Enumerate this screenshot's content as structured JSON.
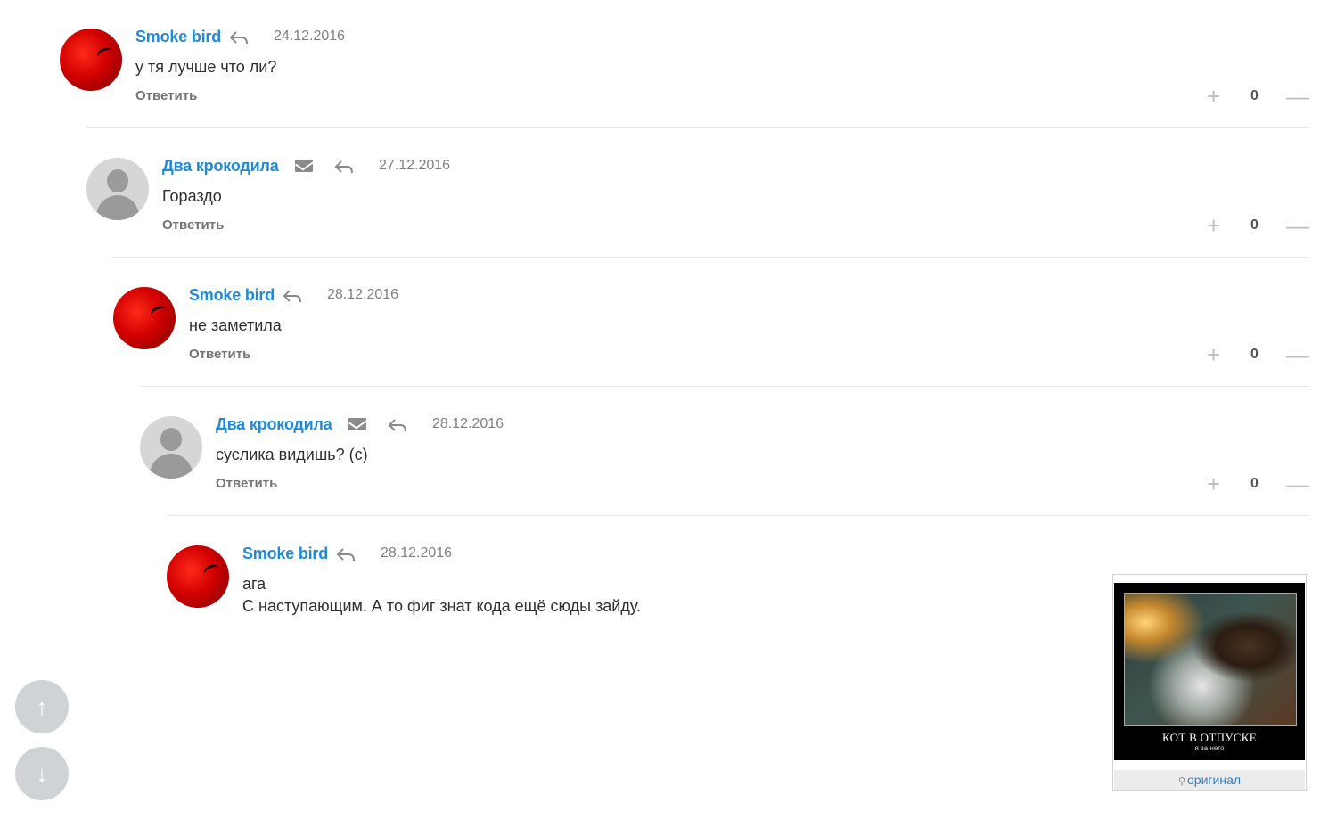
{
  "comments": [
    {
      "author": "Smoke bird",
      "date": "24.12.2016",
      "lines": [
        "у тя лучше что ли?"
      ],
      "reply": "Ответить",
      "score": "0",
      "has_mail": false
    },
    {
      "author": "Два крокодила",
      "date": "27.12.2016",
      "lines": [
        "Гораздо"
      ],
      "reply": "Ответить",
      "score": "0",
      "has_mail": true
    },
    {
      "author": "Smoke bird",
      "date": "28.12.2016",
      "lines": [
        "не заметила"
      ],
      "reply": "Ответить",
      "score": "0",
      "has_mail": false
    },
    {
      "author": "Два крокодила",
      "date": "28.12.2016",
      "lines": [
        "суслика видишь? (с)"
      ],
      "reply": "Ответить",
      "score": "0",
      "has_mail": true
    },
    {
      "author": "Smoke bird",
      "date": "28.12.2016",
      "lines": [
        "ага",
        "С наступающим. А то фиг знат кода ещё сюды зайду."
      ],
      "reply": "",
      "score": "",
      "has_mail": false
    }
  ],
  "icons": {
    "reply": "reply-arrow-icon",
    "mail": "mail-icon",
    "plus": "plus-icon",
    "minus": "minus-icon",
    "up": "arrow-up-icon",
    "down": "arrow-down-icon",
    "key": "key-icon"
  },
  "vote": {
    "plus": "+",
    "minus": "—"
  },
  "scroll": {
    "up": "↑",
    "down": "↓"
  },
  "promo": {
    "caption": "КОТ В ОТПУСКЕ",
    "subcaption": "я за него",
    "original_link": "оригинал"
  },
  "colors": {
    "author": "#1f8ad8",
    "avatar_red": "#d10000",
    "avatar_gray": "#d6d6d6",
    "scroll_button": "#cfd3d6"
  }
}
